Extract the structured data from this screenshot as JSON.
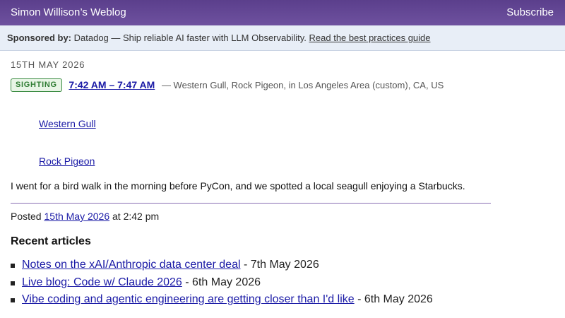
{
  "header": {
    "site_title": "Simon Willison’s Weblog",
    "subscribe_label": "Subscribe"
  },
  "sponsor": {
    "label": "Sponsored by:",
    "text": "Datadog — Ship reliable AI faster with LLM Observability.",
    "link_text": "Read the best practices guide"
  },
  "post": {
    "date_heading": "15th May 2026",
    "badge": "SIGHTING",
    "time_range": "7:42 AM – 7:47 AM",
    "meta": "— Western Gull, Rock Pigeon, in Los Angeles Area (custom), CA, US",
    "species": [
      "Western Gull",
      "Rock Pigeon"
    ],
    "body": "I went for a bird walk in the morning before PyCon, and we spotted a local seagull enjoying a Starbucks.",
    "posted_prefix": "Posted",
    "posted_date": "15th May 2026",
    "posted_suffix": "at 2:42 pm"
  },
  "recent": {
    "title": "Recent articles",
    "items": [
      {
        "title": "Notes on the xAI/Anthropic data center deal",
        "date": "- 7th May 2026"
      },
      {
        "title": "Live blog: Code w/ Claude 2026",
        "date": "- 6th May 2026"
      },
      {
        "title": "Vibe coding and agentic engineering are getting closer than I'd like",
        "date": "- 6th May 2026"
      }
    ]
  },
  "colors": {
    "header_bg": "#5b3f8c",
    "sponsor_bg": "#e8eef7",
    "link": "#1a1aa6",
    "badge_green": "#2f7d33"
  }
}
